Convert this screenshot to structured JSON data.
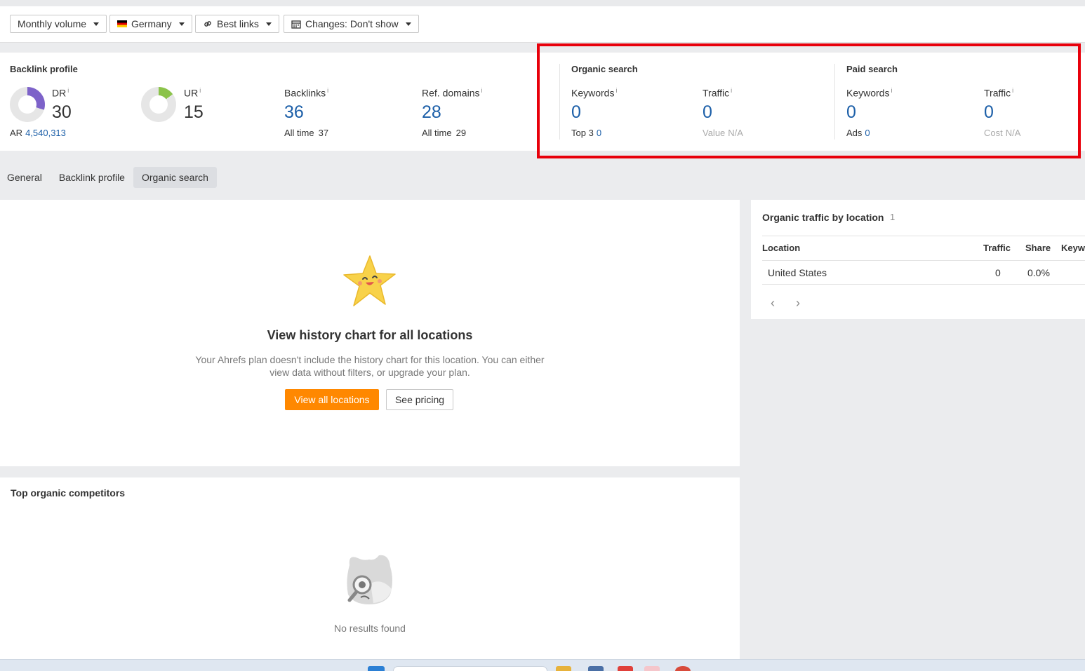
{
  "toolbar": {
    "volume_label": "Monthly volume",
    "country_label": "Germany",
    "links_label": "Best links",
    "changes_label": "Changes: Don't show"
  },
  "backlink_profile": {
    "title": "Backlink profile",
    "dr": {
      "label": "DR",
      "info": "i",
      "value": "30",
      "fraction": 0.3
    },
    "ar": {
      "label": "AR",
      "value": "4,540,313"
    },
    "ur": {
      "label": "UR",
      "info": "i",
      "value": "15",
      "fraction": 0.15
    },
    "backlinks": {
      "label": "Backlinks",
      "info": "i",
      "value": "36",
      "sub_label": "All time",
      "sub_value": "37"
    },
    "ref_domains": {
      "label": "Ref. domains",
      "info": "i",
      "value": "28",
      "sub_label": "All time",
      "sub_value": "29"
    }
  },
  "organic_search": {
    "title": "Organic search",
    "keywords": {
      "label": "Keywords",
      "info": "i",
      "value": "0",
      "sub_label": "Top 3",
      "sub_value": "0"
    },
    "traffic": {
      "label": "Traffic",
      "info": "i",
      "value": "0",
      "sub_label": "Value",
      "sub_value": "N/A"
    }
  },
  "paid_search": {
    "title": "Paid search",
    "keywords": {
      "label": "Keywords",
      "info": "i",
      "value": "0",
      "sub_label": "Ads",
      "sub_value": "0"
    },
    "traffic": {
      "label": "Traffic",
      "info": "i",
      "value": "0",
      "sub_label": "Cost",
      "sub_value": "N/A"
    }
  },
  "tabs": [
    {
      "label": "General",
      "active": false
    },
    {
      "label": "Backlink profile",
      "active": false
    },
    {
      "label": "Organic search",
      "active": true
    }
  ],
  "history": {
    "title": "View history chart for all locations",
    "description": "Your Ahrefs plan doesn't include the history chart for this location. You can either view data without filters, or upgrade your plan.",
    "primary_button": "View all locations",
    "secondary_button": "See pricing"
  },
  "location_panel": {
    "title": "Organic traffic by location",
    "count": "1",
    "columns": [
      "Location",
      "Traffic",
      "Share",
      "Keyw"
    ],
    "rows": [
      {
        "location": "United States",
        "traffic": "0",
        "share": "0.0%"
      }
    ],
    "prev": "‹",
    "next": "›"
  },
  "competitors": {
    "title": "Top organic competitors",
    "empty_text": "No results found"
  },
  "colors": {
    "accent_orange": "#ff8800",
    "value_blue": "#1c5fa8",
    "dr_purple": "#7d62c9",
    "ur_green": "#8bc34a",
    "highlight_red": "#e8000b"
  }
}
